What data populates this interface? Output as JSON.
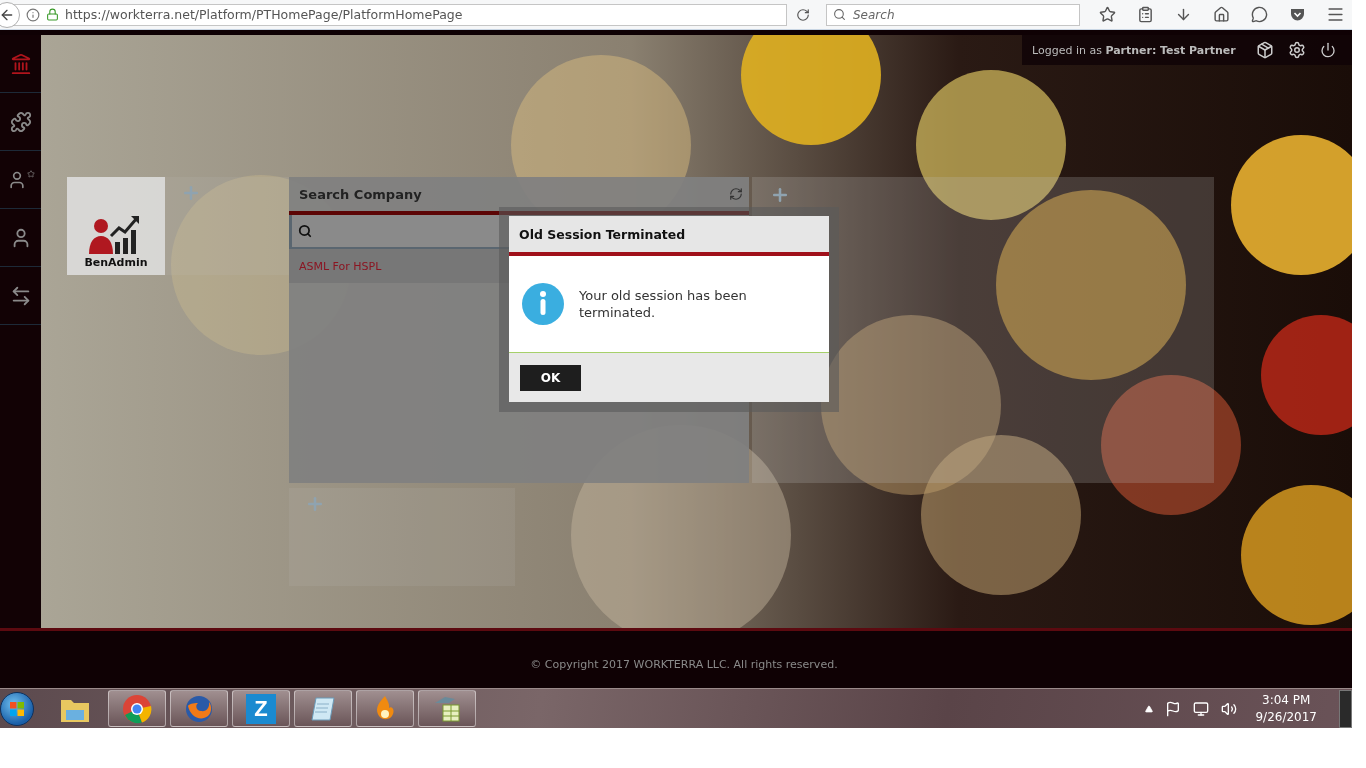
{
  "browser": {
    "url": "https://workterra.net/Platform/PTHomePage/PlatformHomePage",
    "search_placeholder": "Search"
  },
  "header": {
    "prefix": "Logged in as",
    "role": "Partner:",
    "user": "Test Partner"
  },
  "sidebar": {
    "items": [
      {
        "kind": "home",
        "selected": true
      },
      {
        "kind": "puzzle",
        "selected": false
      },
      {
        "kind": "user-star",
        "selected": false
      },
      {
        "kind": "user",
        "selected": false
      },
      {
        "kind": "transfer",
        "selected": false
      }
    ]
  },
  "tiles": [
    {
      "label": "BenAdmin"
    }
  ],
  "search_panel": {
    "title": "Search Company",
    "results": [
      "ASML For HSPL"
    ]
  },
  "dialog": {
    "title": "Old Session Terminated",
    "message": "Your old session has been terminated.",
    "button": "OK"
  },
  "footer": {
    "copyright": "© Copyright 2017 WORKTERRA LLC. All rights reserved."
  },
  "taskbar": {
    "apps": [
      {
        "kind": "folder"
      },
      {
        "kind": "chrome"
      },
      {
        "kind": "firefox"
      },
      {
        "kind": "letter",
        "label": "Z"
      },
      {
        "kind": "notepad"
      },
      {
        "kind": "flame"
      },
      {
        "kind": "sheet"
      }
    ],
    "time": "3:04 PM",
    "date": "9/26/2017"
  }
}
